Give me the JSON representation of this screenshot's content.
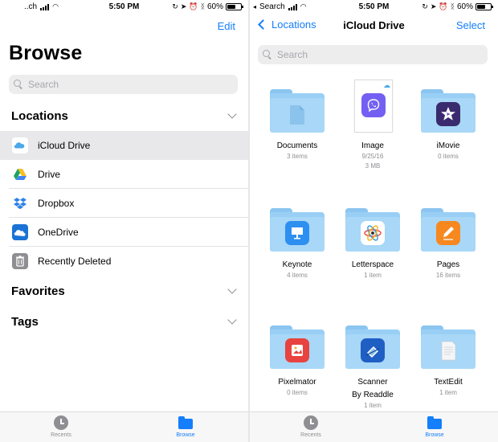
{
  "left": {
    "status": {
      "carrier": "..ch",
      "time": "5:50 PM",
      "battery": "60%"
    },
    "edit_label": "Edit",
    "title": "Browse",
    "search_placeholder": "Search",
    "sections": {
      "locations": "Locations",
      "favorites": "Favorites",
      "tags": "Tags"
    },
    "locations": [
      {
        "label": "iCloud Drive",
        "icon": "icloud-icon",
        "selected": true
      },
      {
        "label": "Drive",
        "icon": "google-drive-icon"
      },
      {
        "label": "Dropbox",
        "icon": "dropbox-icon"
      },
      {
        "label": "OneDrive",
        "icon": "onedrive-icon"
      },
      {
        "label": "Recently Deleted",
        "icon": "trash-icon"
      }
    ],
    "tabs": [
      {
        "label": "Recents",
        "icon": "clock-icon",
        "active": false
      },
      {
        "label": "Browse",
        "icon": "folder-icon",
        "active": true
      }
    ]
  },
  "right": {
    "status": {
      "carrier": "Search",
      "time": "5:50 PM",
      "battery": "60%"
    },
    "back_label": "Locations",
    "title": "iCloud Drive",
    "select_label": "Select",
    "search_placeholder": "Search",
    "items": [
      {
        "name": "Documents",
        "meta": "3 items",
        "icon": "document-folder-icon"
      },
      {
        "name": "Image",
        "meta": "9/25/16",
        "meta2": "3 MB",
        "icon": "viber-image-icon"
      },
      {
        "name": "iMovie",
        "meta": "0 items",
        "icon": "imovie-icon"
      },
      {
        "name": "Keynote",
        "meta": "4 items",
        "icon": "keynote-icon"
      },
      {
        "name": "Letterspace",
        "meta": "1 item",
        "icon": "letterspace-icon"
      },
      {
        "name": "Pages",
        "meta": "16 items",
        "icon": "pages-icon"
      },
      {
        "name": "Pixelmator",
        "meta": "0 items",
        "icon": "pixelmator-icon"
      },
      {
        "name": "Scanner",
        "name2": "By Readdle",
        "meta": "1 item",
        "icon": "scanner-icon"
      },
      {
        "name": "TextEdit",
        "meta": "1 item",
        "icon": "textedit-icon"
      }
    ],
    "tabs": [
      {
        "label": "Recents",
        "icon": "clock-icon",
        "active": false
      },
      {
        "label": "Browse",
        "icon": "folder-icon",
        "active": true
      }
    ]
  },
  "colors": {
    "accent": "#147efb",
    "folder": "#a8d7f7",
    "selected_row": "#e8e8ea",
    "secondary_text": "#8e8e93"
  }
}
